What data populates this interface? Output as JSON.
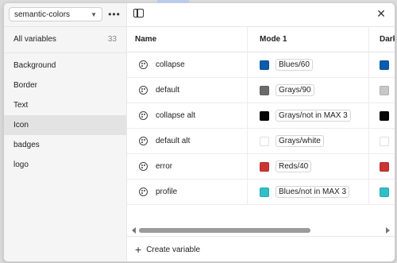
{
  "collection": {
    "selected": "semantic-colors"
  },
  "sidebar": {
    "all_label": "All variables",
    "all_count": "33",
    "groups": [
      "Background",
      "Border",
      "Text",
      "Icon",
      "badges",
      "logo"
    ],
    "active_group": "Icon"
  },
  "table": {
    "columns": [
      "Name",
      "Mode 1",
      "Dark"
    ],
    "rows": [
      {
        "name": "collapse",
        "mode1_value": "Blues/60",
        "mode1_color": "#0b5cad",
        "dark_color": "#0b5cad"
      },
      {
        "name": "default",
        "mode1_value": "Grays/90",
        "mode1_color": "#6b6b6b",
        "dark_color": "#c8c8c8"
      },
      {
        "name": "collapse alt",
        "mode1_value": "Grays/not in MAX 3",
        "mode1_color": "#050505",
        "dark_color": "#050505"
      },
      {
        "name": "default alt",
        "mode1_value": "Grays/white",
        "mode1_color": "#ffffff",
        "dark_color": "#ffffff"
      },
      {
        "name": "error",
        "mode1_value": "Reds/40",
        "mode1_color": "#cc3333",
        "dark_color": "#cc3333"
      },
      {
        "name": "profile",
        "mode1_value": "Blues/not in MAX 3",
        "mode1_color": "#2fbfc9",
        "dark_color": "#2fbfc9"
      }
    ]
  },
  "footer": {
    "create_label": "Create variable"
  },
  "icons": {
    "more": "more-horizontal-icon",
    "toggle": "sidebar-toggle-icon",
    "close": "close-icon",
    "variable": "color-variable-icon",
    "add": "plus-icon"
  }
}
